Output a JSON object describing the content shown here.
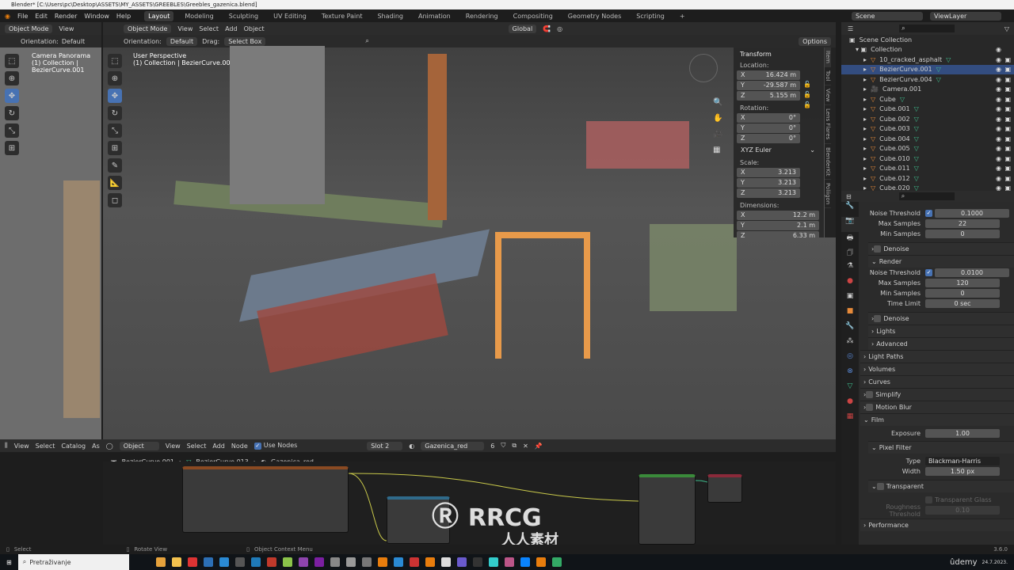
{
  "window": {
    "title": "Blender* [C:\\Users\\pc\\Desktop\\ASSETS\\MY_ASSETS\\GREEBLES\\Greebles_gazenica.blend]"
  },
  "menu": [
    "File",
    "Edit",
    "Render",
    "Window",
    "Help"
  ],
  "workspaces": [
    "Layout",
    "Modeling",
    "Sculpting",
    "UV Editing",
    "Texture Paint",
    "Shading",
    "Animation",
    "Rendering",
    "Compositing",
    "Geometry Nodes",
    "Scripting",
    "+"
  ],
  "scene": {
    "name": "Scene",
    "view_layer": "ViewLayer"
  },
  "left_viewport": {
    "mode": "Object Mode",
    "view": "View",
    "orientation_label": "Orientation:",
    "orientation": "Default",
    "overlay_title": "Camera Panorama",
    "overlay_sub": "(1) Collection | BezierCurve.001"
  },
  "viewport": {
    "mode": "Object Mode",
    "menus": [
      "View",
      "Select",
      "Add",
      "Object"
    ],
    "orientation_label": "Orientation:",
    "orientation": "Default",
    "drag_label": "Drag:",
    "drag": "Select Box",
    "transform": "Global",
    "options": "Options",
    "overlay_title": "User Perspective",
    "overlay_sub": "(1) Collection | BezierCurve.001"
  },
  "npanel": {
    "title": "Transform",
    "location_label": "Location:",
    "location": [
      [
        "X",
        "16.424 m"
      ],
      [
        "Y",
        "-29.587 m"
      ],
      [
        "Z",
        "5.155 m"
      ]
    ],
    "rotation_label": "Rotation:",
    "rotation": [
      [
        "X",
        "0°"
      ],
      [
        "Y",
        "0°"
      ],
      [
        "Z",
        "0°"
      ]
    ],
    "rotation_mode": "XYZ Euler",
    "scale_label": "Scale:",
    "scale": [
      [
        "X",
        "3.213"
      ],
      [
        "Y",
        "3.213"
      ],
      [
        "Z",
        "3.213"
      ]
    ],
    "dimensions_label": "Dimensions:",
    "dimensions": [
      [
        "X",
        "12.2 m"
      ],
      [
        "Y",
        "2.1 m"
      ],
      [
        "Z",
        "6.33 m"
      ]
    ],
    "tabs": [
      "Item",
      "Tool",
      "View",
      "Lens Flares",
      "BlenderKit",
      "Poliigon"
    ]
  },
  "outliner": {
    "root": "Scene Collection",
    "collection": "Collection",
    "items": [
      "10_cracked_asphalt",
      "BezierCurve.001",
      "BezierCurve.004",
      "Camera.001",
      "Cube",
      "Cube.001",
      "Cube.002",
      "Cube.003",
      "Cube.004",
      "Cube.005",
      "Cube.010",
      "Cube.011",
      "Cube.012",
      "Cube.020"
    ],
    "selected": "BezierCurve.001"
  },
  "properties": {
    "viewport_sampling": {
      "noise_threshold_label": "Noise Threshold",
      "noise_threshold": "0.1000",
      "max_samples_label": "Max Samples",
      "max_samples": "22",
      "min_samples_label": "Min Samples",
      "min_samples": "0",
      "denoise": "Denoise"
    },
    "render_label": "Render",
    "render_sampling": {
      "noise_threshold_label": "Noise Threshold",
      "noise_threshold": "0.0100",
      "max_samples_label": "Max Samples",
      "max_samples": "120",
      "min_samples_label": "Min Samples",
      "min_samples": "0",
      "time_limit_label": "Time Limit",
      "time_limit": "0 sec",
      "denoise": "Denoise"
    },
    "sub": [
      "Lights",
      "Advanced"
    ],
    "sections": [
      "Light Paths",
      "Volumes",
      "Curves",
      "Simplify",
      "Motion Blur"
    ],
    "film": {
      "label": "Film",
      "exposure_label": "Exposure",
      "exposure": "1.00",
      "pixel_filter": "Pixel Filter",
      "type_label": "Type",
      "type": "Blackman-Harris",
      "width_label": "Width",
      "width": "1.50 px",
      "transparent": "Transparent",
      "transparent_glass": "Transparent Glass",
      "roughness_label": "Roughness Threshold",
      "roughness": "0.10"
    },
    "performance": "Performance"
  },
  "node_editor": {
    "menus": [
      "View",
      "Select",
      "Catalog",
      "As"
    ],
    "object": "Object",
    "menus2": [
      "View",
      "Select",
      "Add",
      "Node"
    ],
    "use_nodes": "Use Nodes",
    "slot": "Slot 2",
    "material": "Gazenica_red",
    "users": "6",
    "breadcrumb": [
      "BezierCurve.001",
      "BezierCurve.013",
      "Gazenica_red"
    ]
  },
  "status": {
    "select": "Select",
    "rotate": "Rotate View",
    "context": "Object Context Menu",
    "version": "3.6.0"
  },
  "taskbar": {
    "search": "Pretraživanje",
    "date": "24.7.2023."
  },
  "watermark": {
    "text": "RRCG",
    "sub": "人人素材",
    "udemy": "ûdemy"
  },
  "colors": {
    "accent": "#4772b3",
    "selected_row": "#334d80",
    "object_orange": "#e68a3a",
    "mesh_green": "#3fbf8f"
  }
}
